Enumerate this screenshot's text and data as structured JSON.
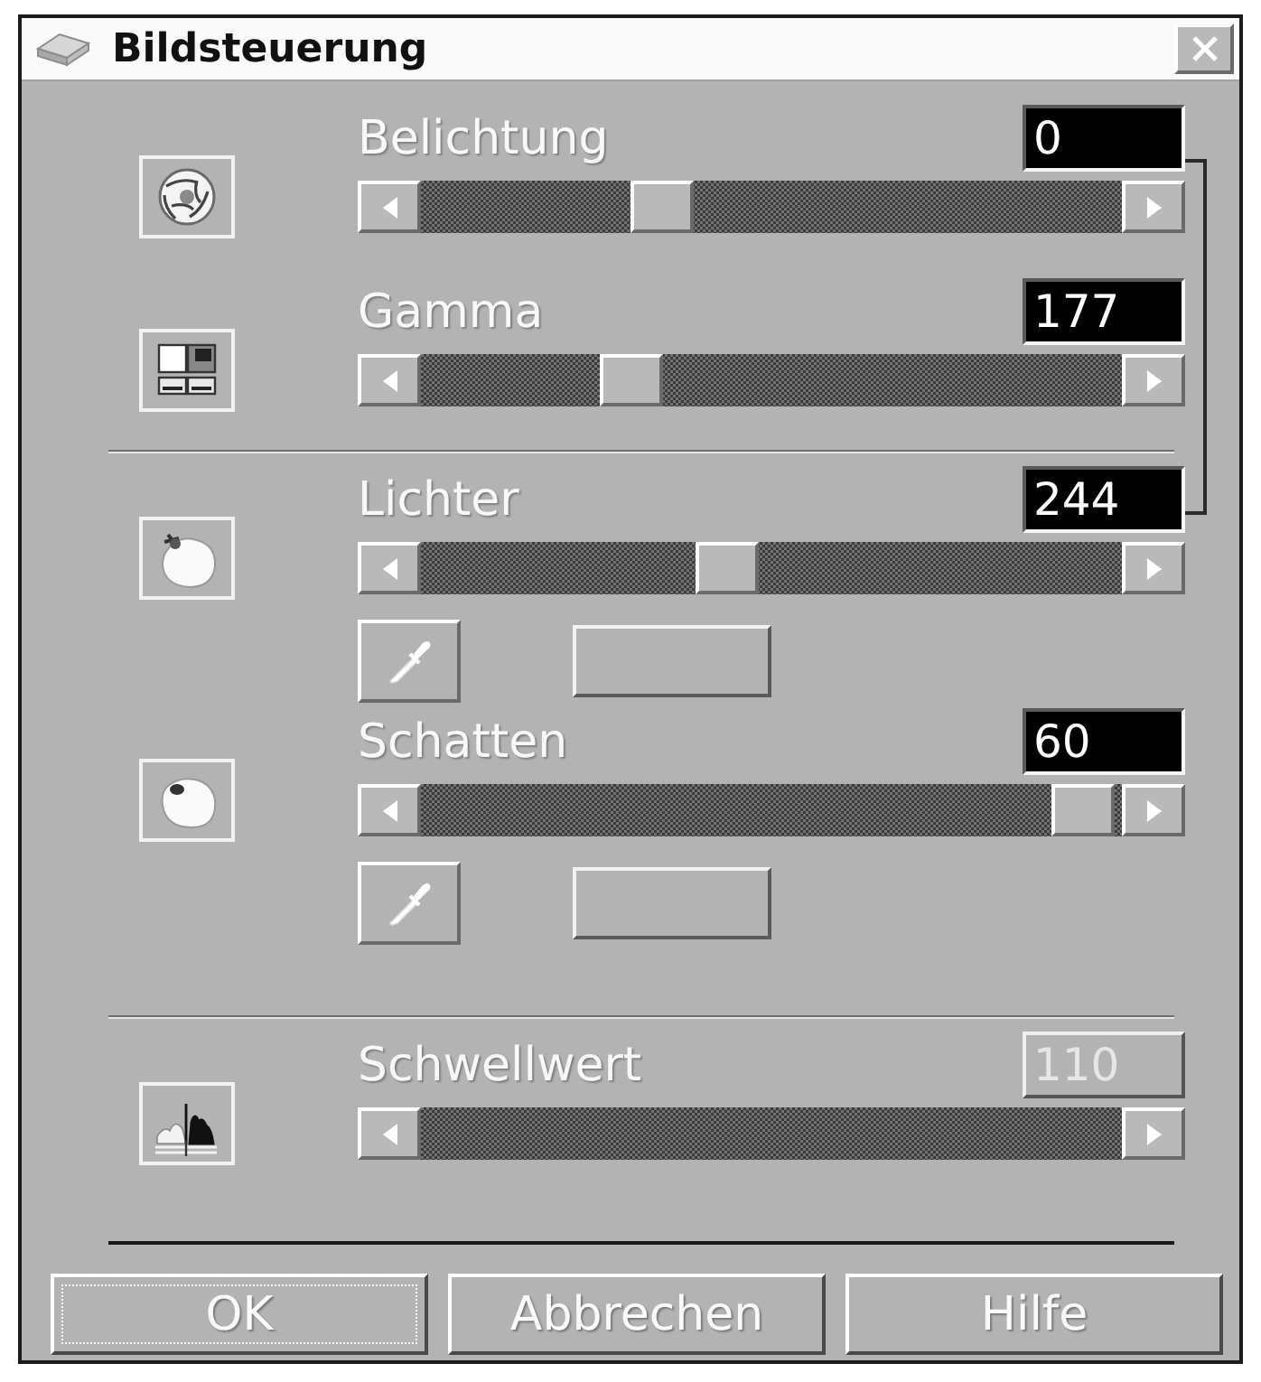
{
  "window": {
    "title": "Bildsteuerung"
  },
  "groups": [
    {
      "controls": [
        {
          "kind": "exposure",
          "label": "Belichtung",
          "value": "0",
          "level": 0.33,
          "disabled": false,
          "picker": false
        },
        {
          "kind": "gamma",
          "label": "Gamma",
          "value": "177",
          "level": 0.28,
          "disabled": false,
          "picker": false
        }
      ]
    },
    {
      "controls": [
        {
          "kind": "highlights",
          "label": "Lichter",
          "value": "244",
          "level": 0.43,
          "disabled": false,
          "picker": true
        },
        {
          "kind": "shadows",
          "label": "Schatten",
          "value": "60",
          "level": 0.99,
          "disabled": false,
          "picker": true
        }
      ]
    },
    {
      "controls": [
        {
          "kind": "threshold",
          "label": "Schwellwert",
          "value": "110",
          "disabled": true,
          "picker": false
        }
      ]
    }
  ],
  "buttons": [
    {
      "label": "OK",
      "focused": true
    },
    {
      "label": "Abbrechen",
      "focused": false
    },
    {
      "label": "Hilfe",
      "focused": false
    }
  ]
}
